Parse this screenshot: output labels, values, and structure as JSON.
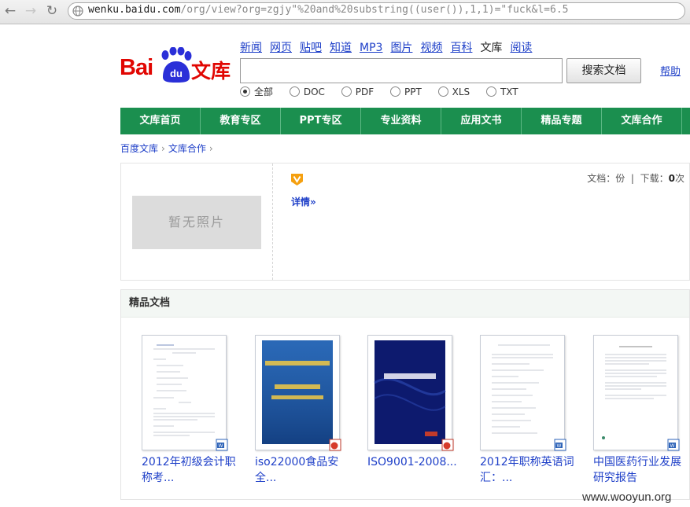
{
  "browser": {
    "url_host": "wenku.baidu.com",
    "url_path": "/org/view?org=zgjy\"%20and%20substring((user()),1,1)=\"fuck&l=6.5"
  },
  "logo": {
    "brand": "Bai",
    "paw_text": "du",
    "product": "文库"
  },
  "top_links": [
    "新闻",
    "网页",
    "贴吧",
    "知道",
    "MP3",
    "图片",
    "视频",
    "百科"
  ],
  "top_current": "文库",
  "top_last": "阅读",
  "search": {
    "value": "",
    "button": "搜索文档",
    "help": "帮助"
  },
  "filters": [
    {
      "label": "全部",
      "checked": true
    },
    {
      "label": "DOC",
      "checked": false
    },
    {
      "label": "PDF",
      "checked": false
    },
    {
      "label": "PPT",
      "checked": false
    },
    {
      "label": "XLS",
      "checked": false
    },
    {
      "label": "TXT",
      "checked": false
    }
  ],
  "nav": [
    "文库首页",
    "教育专区",
    "PPT专区",
    "专业资料",
    "应用文书",
    "精品专题",
    "文库合作"
  ],
  "breadcrumb": [
    "百度文库",
    "文库合作"
  ],
  "doc": {
    "no_photo": "暂无照片",
    "details": "详情»",
    "stats_label_docs": "文档：",
    "stats_docs_unit": "份",
    "stats_label_downloads": "下载：",
    "stats_downloads": "0",
    "stats_downloads_unit": "次"
  },
  "featured": {
    "title": "精品文档",
    "items": [
      {
        "title": "2012年初级会计职称考...",
        "type": "doc",
        "thumb": "text"
      },
      {
        "title": "iso22000食品安全...",
        "type": "ppt",
        "thumb": "blue-cover"
      },
      {
        "title": "ISO9001-2008...",
        "type": "ppt",
        "thumb": "navy-cover"
      },
      {
        "title": "2012年职称英语词汇：...",
        "type": "doc",
        "thumb": "text"
      },
      {
        "title": "中国医药行业发展研究报告",
        "type": "doc",
        "thumb": "text"
      }
    ]
  },
  "watermark": "www.wooyun.org",
  "colors": {
    "brand_red": "#e10602",
    "paw_blue": "#2a2fd8",
    "nav_green": "#1b8f4f",
    "link_blue": "#1e3fc8"
  }
}
